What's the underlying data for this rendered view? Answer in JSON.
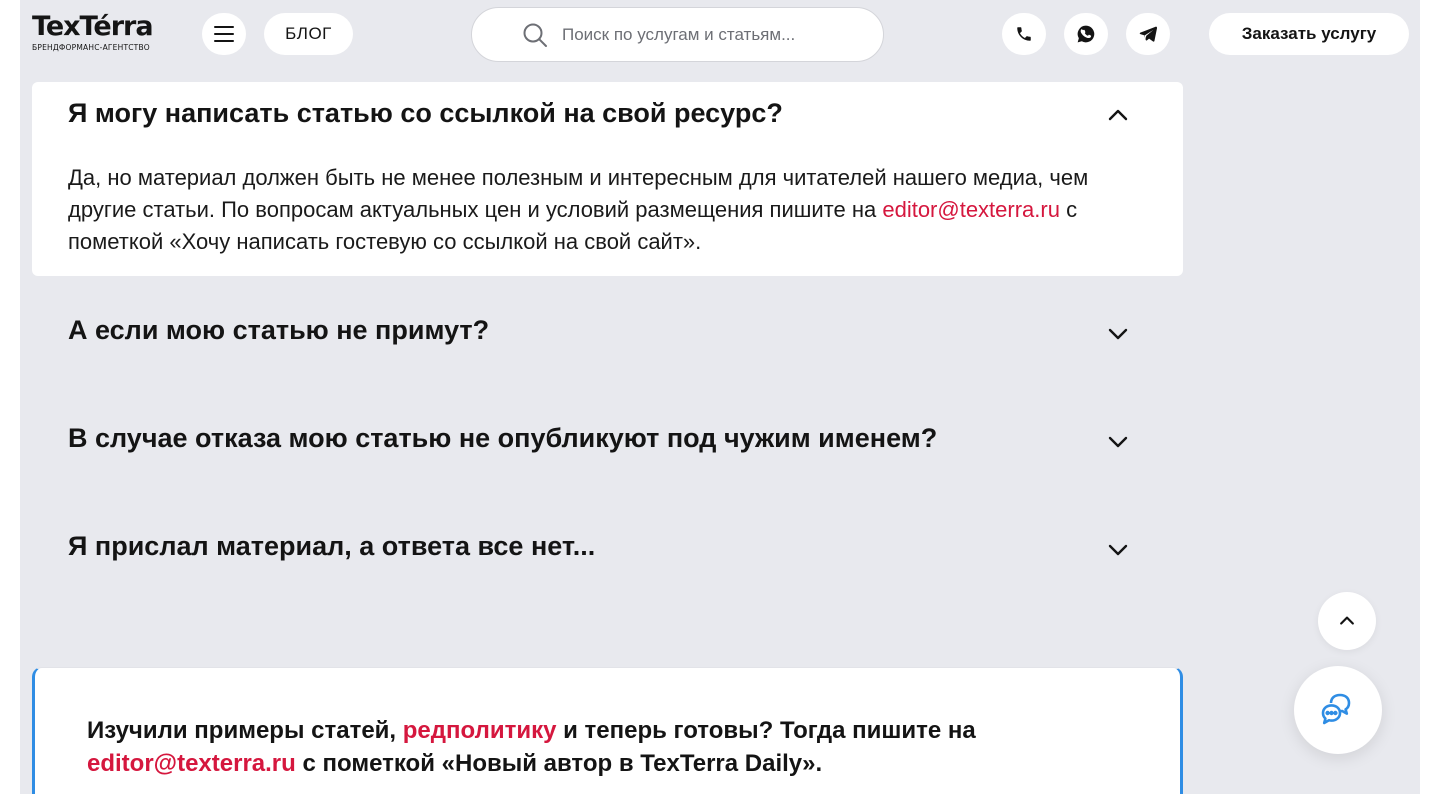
{
  "header": {
    "logo_text": "TexTérra",
    "logo_subtitle": "БРЕНДФОРМАНС-АГЕНТСТВО",
    "blog_label": "БЛОГ",
    "search_placeholder": "Поиск по услугам и статьям...",
    "order_label": "Заказать услугу"
  },
  "faq": {
    "items": [
      {
        "question": "Я могу написать статью со ссылкой на свой ресурс?",
        "expanded": true,
        "answer": {
          "text_1": "Да, но материал должен быть не менее полезным и интересным для читателей нашего медиа, чем другие статьи. По вопросам актуальных цен и условий размещения пишите на ",
          "email": "editor@texterra.ru",
          "text_2": " с пометкой «Хочу написать гостевую со ссылкой на свой сайт»."
        }
      },
      {
        "question": "А если мою статью не примут?",
        "expanded": false
      },
      {
        "question": "В случае отказа мою статью не опубликуют под чужим именем?",
        "expanded": false
      },
      {
        "question": "Я прислал материал, а ответа все нет...",
        "expanded": false
      }
    ]
  },
  "callout": {
    "text_1": "Изучили примеры статей, ",
    "link": "редполитику",
    "text_2": " и теперь готовы? Тогда пишите на ",
    "email": "editor@texterra.ru",
    "text_3": " с пометкой «Новый автор в TexTerra Daily»."
  },
  "colors": {
    "accent": "#d5173e",
    "callout_border": "#2f8de4",
    "chat_icon": "#2f8de4",
    "page_background": "#e8e9ee"
  },
  "icons": [
    "menu-icon",
    "search-icon",
    "phone-icon",
    "whatsapp-icon",
    "telegram-icon",
    "chevron-up-icon",
    "chevron-down-icon",
    "chat-icon"
  ]
}
